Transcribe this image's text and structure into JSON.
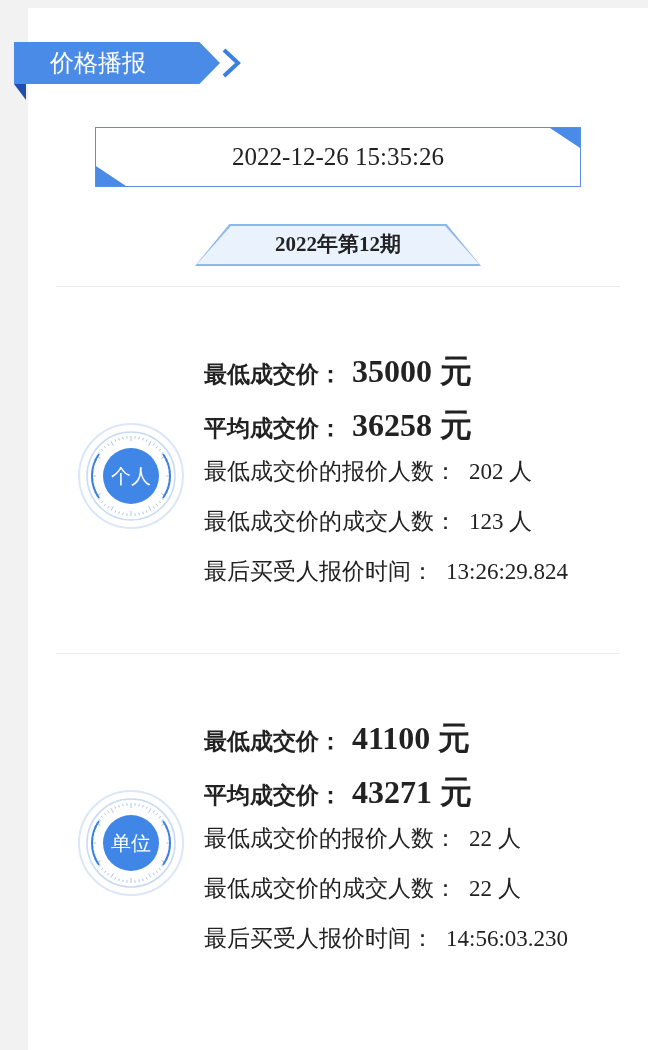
{
  "header": {
    "title": "价格播报"
  },
  "datetime": "2022-12-26 15:35:26",
  "issue": "2022年第12期",
  "sections": [
    {
      "badge": "个人",
      "rows": [
        {
          "kind": "major",
          "label": "最低成交价：",
          "value": "35000 元"
        },
        {
          "kind": "major",
          "label": "平均成交价：",
          "value": "36258 元"
        },
        {
          "kind": "minor",
          "label": "最低成交价的报价人数：",
          "value": "202 人"
        },
        {
          "kind": "minor",
          "label": "最低成交价的成交人数：",
          "value": "123 人"
        },
        {
          "kind": "minor",
          "label": "最后买受人报价时间：",
          "value": "13:26:29.824"
        }
      ]
    },
    {
      "badge": "单位",
      "rows": [
        {
          "kind": "major",
          "label": "最低成交价：",
          "value": "41100 元"
        },
        {
          "kind": "major",
          "label": "平均成交价：",
          "value": "43271 元"
        },
        {
          "kind": "minor",
          "label": "最低成交价的报价人数：",
          "value": "22 人"
        },
        {
          "kind": "minor",
          "label": "最低成交价的成交人数：",
          "value": "22 人"
        },
        {
          "kind": "minor",
          "label": "最后买受人报价时间：",
          "value": "14:56:03.230"
        }
      ]
    }
  ]
}
